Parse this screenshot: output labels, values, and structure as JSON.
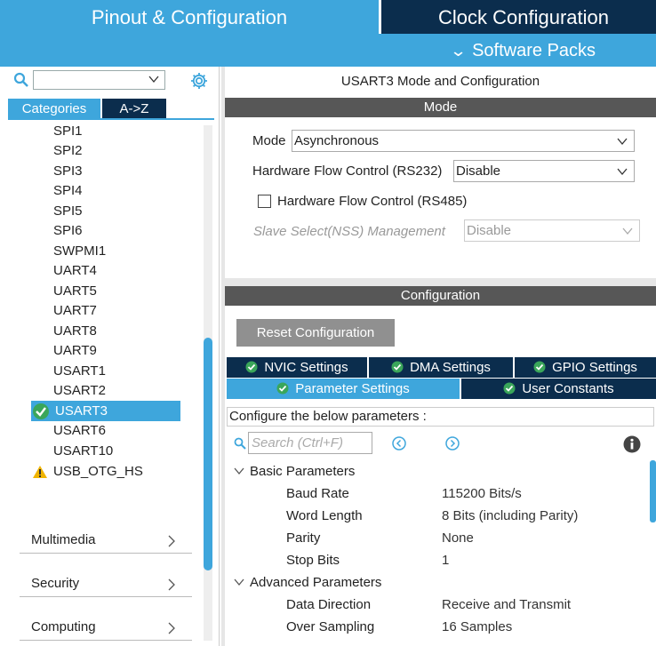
{
  "tabs": {
    "pinout": "Pinout & Configuration",
    "clock": "Clock Configuration"
  },
  "software_packs": "Software Packs",
  "left": {
    "categories_tab": "Categories",
    "az_tab": "A->Z",
    "peripherals": [
      "SPI1",
      "SPI2",
      "SPI3",
      "SPI4",
      "SPI5",
      "SPI6",
      "SWPMI1",
      "UART4",
      "UART5",
      "UART7",
      "UART8",
      "UART9",
      "USART1",
      "USART2"
    ],
    "selected": "USART3",
    "after_selected": [
      "USART6",
      "USART10"
    ],
    "warning_item": "USB_OTG_HS",
    "categories": [
      "Multimedia",
      "Security",
      "Computing"
    ]
  },
  "mode": {
    "title": "USART3 Mode and Configuration",
    "header": "Mode",
    "mode_label": "Mode",
    "mode_value": "Asynchronous",
    "hw_flow_label": "Hardware Flow Control (RS232)",
    "hw_flow_value": "Disable",
    "rs485_label": "Hardware Flow Control (RS485)",
    "nss_label": "Slave Select(NSS) Management",
    "nss_value": "Disable"
  },
  "config": {
    "header": "Configuration",
    "reset_button": "Reset Configuration",
    "tabs_row1": [
      "NVIC Settings",
      "DMA Settings",
      "GPIO Settings"
    ],
    "tabs_row2": [
      "Parameter Settings",
      "User Constants"
    ],
    "hint": "Configure the below parameters :",
    "search_placeholder": "Search (Ctrl+F)",
    "groups": {
      "basic": "Basic Parameters",
      "advanced": "Advanced Parameters"
    },
    "basic_params": [
      {
        "name": "Baud Rate",
        "value": "115200 Bits/s"
      },
      {
        "name": "Word Length",
        "value": "8 Bits (including Parity)"
      },
      {
        "name": "Parity",
        "value": "None"
      },
      {
        "name": "Stop Bits",
        "value": "1"
      }
    ],
    "advanced_params": [
      {
        "name": "Data Direction",
        "value": "Receive and Transmit"
      },
      {
        "name": "Over Sampling",
        "value": "16 Samples"
      }
    ]
  },
  "colors": {
    "accent": "#3ea6dc",
    "dark": "#0b2d4d",
    "header_gray": "#575757",
    "check_green": "#3aa65a",
    "warning": "#f0b400"
  }
}
